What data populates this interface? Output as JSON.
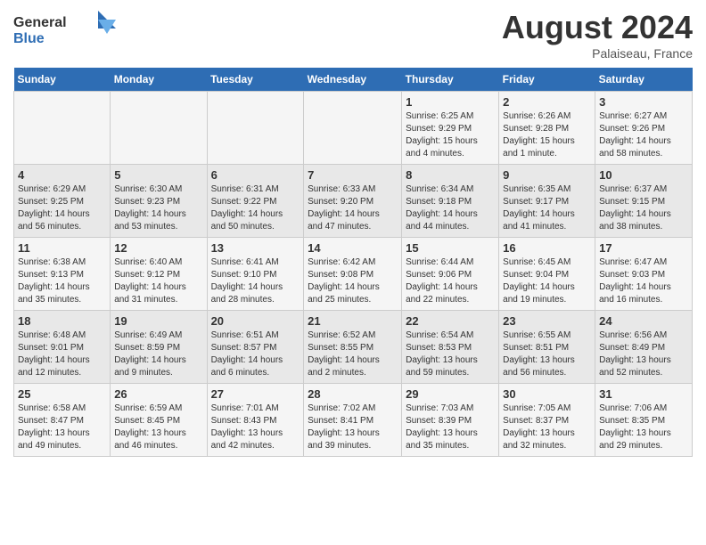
{
  "header": {
    "logo_general": "General",
    "logo_blue": "Blue",
    "month_year": "August 2024",
    "location": "Palaiseau, France"
  },
  "weekdays": [
    "Sunday",
    "Monday",
    "Tuesday",
    "Wednesday",
    "Thursday",
    "Friday",
    "Saturday"
  ],
  "weeks": [
    [
      {
        "day": "",
        "info": ""
      },
      {
        "day": "",
        "info": ""
      },
      {
        "day": "",
        "info": ""
      },
      {
        "day": "",
        "info": ""
      },
      {
        "day": "1",
        "info": "Sunrise: 6:25 AM\nSunset: 9:29 PM\nDaylight: 15 hours\nand 4 minutes."
      },
      {
        "day": "2",
        "info": "Sunrise: 6:26 AM\nSunset: 9:28 PM\nDaylight: 15 hours\nand 1 minute."
      },
      {
        "day": "3",
        "info": "Sunrise: 6:27 AM\nSunset: 9:26 PM\nDaylight: 14 hours\nand 58 minutes."
      }
    ],
    [
      {
        "day": "4",
        "info": "Sunrise: 6:29 AM\nSunset: 9:25 PM\nDaylight: 14 hours\nand 56 minutes."
      },
      {
        "day": "5",
        "info": "Sunrise: 6:30 AM\nSunset: 9:23 PM\nDaylight: 14 hours\nand 53 minutes."
      },
      {
        "day": "6",
        "info": "Sunrise: 6:31 AM\nSunset: 9:22 PM\nDaylight: 14 hours\nand 50 minutes."
      },
      {
        "day": "7",
        "info": "Sunrise: 6:33 AM\nSunset: 9:20 PM\nDaylight: 14 hours\nand 47 minutes."
      },
      {
        "day": "8",
        "info": "Sunrise: 6:34 AM\nSunset: 9:18 PM\nDaylight: 14 hours\nand 44 minutes."
      },
      {
        "day": "9",
        "info": "Sunrise: 6:35 AM\nSunset: 9:17 PM\nDaylight: 14 hours\nand 41 minutes."
      },
      {
        "day": "10",
        "info": "Sunrise: 6:37 AM\nSunset: 9:15 PM\nDaylight: 14 hours\nand 38 minutes."
      }
    ],
    [
      {
        "day": "11",
        "info": "Sunrise: 6:38 AM\nSunset: 9:13 PM\nDaylight: 14 hours\nand 35 minutes."
      },
      {
        "day": "12",
        "info": "Sunrise: 6:40 AM\nSunset: 9:12 PM\nDaylight: 14 hours\nand 31 minutes."
      },
      {
        "day": "13",
        "info": "Sunrise: 6:41 AM\nSunset: 9:10 PM\nDaylight: 14 hours\nand 28 minutes."
      },
      {
        "day": "14",
        "info": "Sunrise: 6:42 AM\nSunset: 9:08 PM\nDaylight: 14 hours\nand 25 minutes."
      },
      {
        "day": "15",
        "info": "Sunrise: 6:44 AM\nSunset: 9:06 PM\nDaylight: 14 hours\nand 22 minutes."
      },
      {
        "day": "16",
        "info": "Sunrise: 6:45 AM\nSunset: 9:04 PM\nDaylight: 14 hours\nand 19 minutes."
      },
      {
        "day": "17",
        "info": "Sunrise: 6:47 AM\nSunset: 9:03 PM\nDaylight: 14 hours\nand 16 minutes."
      }
    ],
    [
      {
        "day": "18",
        "info": "Sunrise: 6:48 AM\nSunset: 9:01 PM\nDaylight: 14 hours\nand 12 minutes."
      },
      {
        "day": "19",
        "info": "Sunrise: 6:49 AM\nSunset: 8:59 PM\nDaylight: 14 hours\nand 9 minutes."
      },
      {
        "day": "20",
        "info": "Sunrise: 6:51 AM\nSunset: 8:57 PM\nDaylight: 14 hours\nand 6 minutes."
      },
      {
        "day": "21",
        "info": "Sunrise: 6:52 AM\nSunset: 8:55 PM\nDaylight: 14 hours\nand 2 minutes."
      },
      {
        "day": "22",
        "info": "Sunrise: 6:54 AM\nSunset: 8:53 PM\nDaylight: 13 hours\nand 59 minutes."
      },
      {
        "day": "23",
        "info": "Sunrise: 6:55 AM\nSunset: 8:51 PM\nDaylight: 13 hours\nand 56 minutes."
      },
      {
        "day": "24",
        "info": "Sunrise: 6:56 AM\nSunset: 8:49 PM\nDaylight: 13 hours\nand 52 minutes."
      }
    ],
    [
      {
        "day": "25",
        "info": "Sunrise: 6:58 AM\nSunset: 8:47 PM\nDaylight: 13 hours\nand 49 minutes."
      },
      {
        "day": "26",
        "info": "Sunrise: 6:59 AM\nSunset: 8:45 PM\nDaylight: 13 hours\nand 46 minutes."
      },
      {
        "day": "27",
        "info": "Sunrise: 7:01 AM\nSunset: 8:43 PM\nDaylight: 13 hours\nand 42 minutes."
      },
      {
        "day": "28",
        "info": "Sunrise: 7:02 AM\nSunset: 8:41 PM\nDaylight: 13 hours\nand 39 minutes."
      },
      {
        "day": "29",
        "info": "Sunrise: 7:03 AM\nSunset: 8:39 PM\nDaylight: 13 hours\nand 35 minutes."
      },
      {
        "day": "30",
        "info": "Sunrise: 7:05 AM\nSunset: 8:37 PM\nDaylight: 13 hours\nand 32 minutes."
      },
      {
        "day": "31",
        "info": "Sunrise: 7:06 AM\nSunset: 8:35 PM\nDaylight: 13 hours\nand 29 minutes."
      }
    ]
  ]
}
